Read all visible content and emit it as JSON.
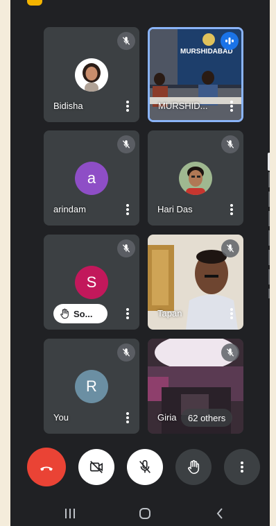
{
  "participants": [
    {
      "name": "Bidisha",
      "muted": true
    },
    {
      "name": "MURSHID...",
      "sign_text": "MURSHIDABAD",
      "speaking": true
    },
    {
      "name": "arindam",
      "initial": "a",
      "avatar_color": "#8e4ec6",
      "muted": true
    },
    {
      "name": "Hari Das",
      "muted": true
    },
    {
      "name": "So...",
      "initial": "S",
      "avatar_color": "#c2185b",
      "muted": true,
      "hand_raised": true
    },
    {
      "name": "Tapan",
      "muted": true
    },
    {
      "name": "You",
      "initial": "R",
      "avatar_color": "#6b8fa3",
      "muted": true
    },
    {
      "name": "Giria",
      "muted": true
    }
  ],
  "others_label": "62 others",
  "controls": {
    "end_call": {
      "icon": "phone-hangup-icon",
      "color": "#ea4335"
    },
    "camera": {
      "icon": "camera-off-icon"
    },
    "mic": {
      "icon": "mic-off-icon"
    },
    "raise_hand": {
      "icon": "hand-icon"
    },
    "more": {
      "icon": "more-vert-icon"
    }
  },
  "system_nav": [
    "recents-icon",
    "home-icon",
    "back-icon"
  ]
}
